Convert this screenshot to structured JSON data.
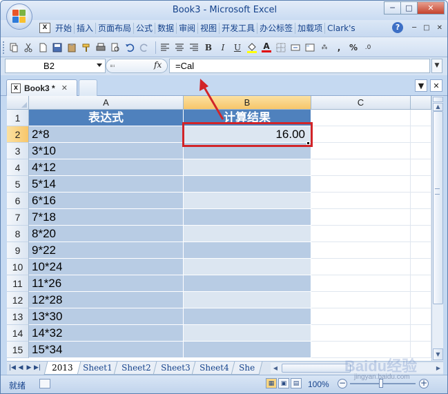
{
  "window": {
    "title": "Book3 - Microsoft Excel",
    "controls": {
      "minimize": "─",
      "restore": "□",
      "close": "✕"
    }
  },
  "menu": {
    "items": [
      "开始",
      "插入",
      "页面布局",
      "公式",
      "数据",
      "审阅",
      "视图",
      "开发工具",
      "办公标签",
      "加载项",
      "Clark's"
    ],
    "help": "?",
    "ctl_min": "─",
    "ctl_restore": "□",
    "ctl_close": "✕"
  },
  "toolbar": {
    "icons": [
      "scissors-icon",
      "copy-icon",
      "save-icon",
      "paste-icon",
      "brush-icon",
      "print-icon",
      "preview-icon",
      "undo-icon",
      "redo-icon",
      "align-left-icon",
      "align-center-icon",
      "align-right-icon",
      "bold-icon",
      "italic-icon",
      "underline-icon",
      "fill-color-icon",
      "font-color-icon",
      "borders-icon",
      "merge-icon",
      "cell-format-icon",
      "currency-icon",
      "comma-icon",
      "percent-icon"
    ],
    "bold": "B",
    "italic": "I",
    "underline": "U",
    "font_color": "A",
    "comma": ",",
    "percent": "%"
  },
  "formula_bar": {
    "name_box": "B2",
    "fx": "fx",
    "formula": "=Cal"
  },
  "workbook_tabs": {
    "active": "Book3 *",
    "close": "✕",
    "ctl_down": "▼",
    "ctl_close": "✕"
  },
  "columns": [
    "A",
    "B",
    "C"
  ],
  "rows": [
    {
      "num": "1",
      "a": "表达式",
      "b": "计算结果",
      "header": true
    },
    {
      "num": "2",
      "a": "2*8",
      "b": "16.00"
    },
    {
      "num": "3",
      "a": "3*10",
      "b": ""
    },
    {
      "num": "4",
      "a": "4*12",
      "b": ""
    },
    {
      "num": "5",
      "a": "5*14",
      "b": ""
    },
    {
      "num": "6",
      "a": "6*16",
      "b": ""
    },
    {
      "num": "7",
      "a": "7*18",
      "b": ""
    },
    {
      "num": "8",
      "a": "8*20",
      "b": ""
    },
    {
      "num": "9",
      "a": "9*22",
      "b": ""
    },
    {
      "num": "10",
      "a": "10*24",
      "b": ""
    },
    {
      "num": "11",
      "a": "11*26",
      "b": ""
    },
    {
      "num": "12",
      "a": "12*28",
      "b": ""
    },
    {
      "num": "13",
      "a": "13*30",
      "b": ""
    },
    {
      "num": "14",
      "a": "14*32",
      "b": ""
    },
    {
      "num": "15",
      "a": "15*34",
      "b": ""
    }
  ],
  "sheet_tabs": [
    "2013",
    "Sheet1",
    "Sheet2",
    "Sheet3",
    "Sheet4",
    "She"
  ],
  "status": {
    "ready": "就绪",
    "zoom": "100%",
    "zoom_minus": "−",
    "zoom_plus": "+"
  },
  "watermark": {
    "main": "Baidu经验",
    "sub": "jingyan.baidu.com"
  },
  "colors": {
    "header_fill": "#4f81bd",
    "band_dark": "#b8cce4",
    "band_light": "#dce6f1",
    "highlight": "#d22428"
  }
}
